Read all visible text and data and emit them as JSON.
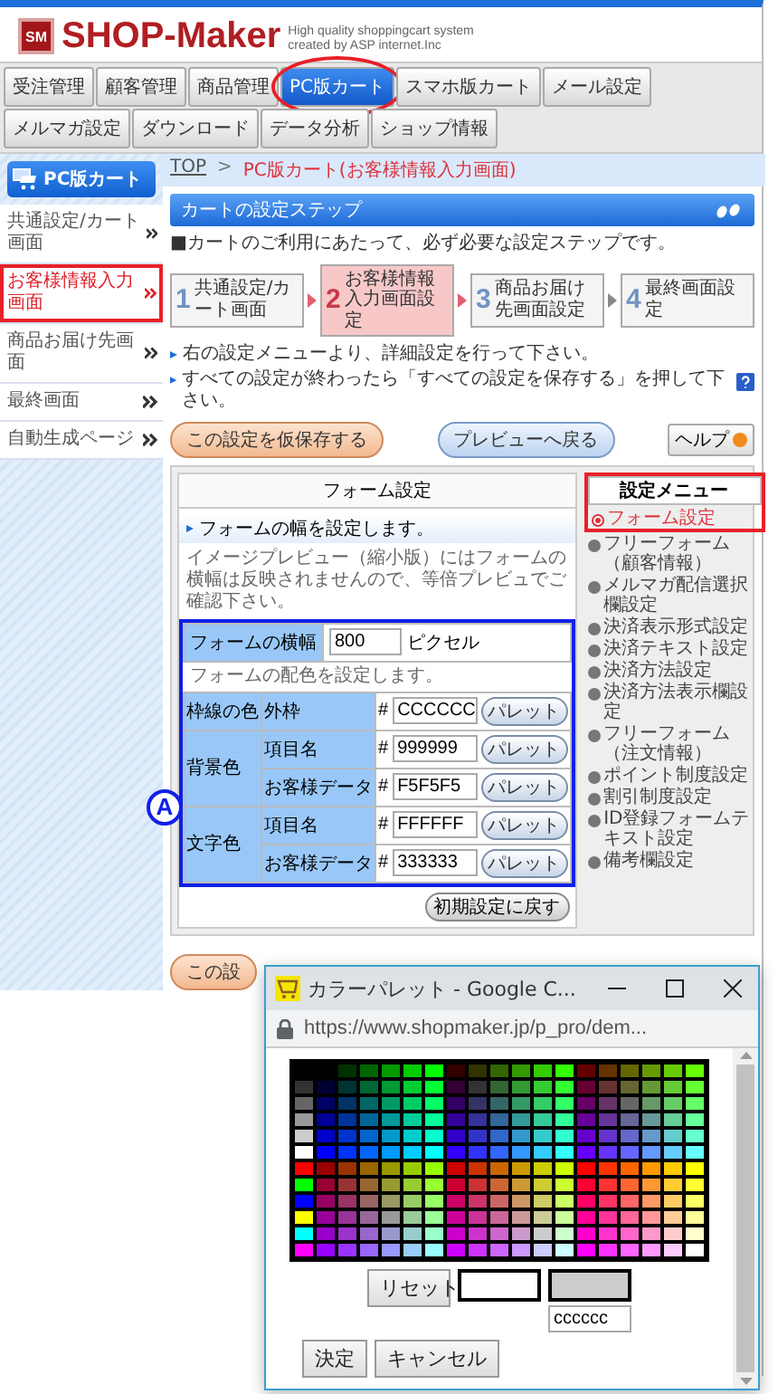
{
  "logo": {
    "mark": "SM",
    "brand": "SHOP-Maker",
    "tagline": [
      "High quality shoppingcart system",
      "created by ASP internet.Inc"
    ]
  },
  "nav": [
    {
      "label": "受注管理",
      "selected": false,
      "highlighted": false
    },
    {
      "label": "顧客管理",
      "selected": false,
      "highlighted": false
    },
    {
      "label": "商品管理",
      "selected": false,
      "highlighted": false
    },
    {
      "label": "PC版カート",
      "selected": true,
      "highlighted": true
    },
    {
      "label": "スマホ版カート",
      "selected": false,
      "highlighted": false
    },
    {
      "label": "メール設定",
      "selected": false,
      "highlighted": false
    },
    {
      "label": "メルマガ設定",
      "selected": false,
      "highlighted": false
    },
    {
      "label": "ダウンロード",
      "selected": false,
      "highlighted": false
    },
    {
      "label": "データ分析",
      "selected": false,
      "highlighted": false
    },
    {
      "label": "ショップ情報",
      "selected": false,
      "highlighted": false
    }
  ],
  "breadcrumb": {
    "home": "TOP",
    "separator": ">",
    "current": "PC版カート(お客様情報入力画面)"
  },
  "sidebar": {
    "title": "PC版カート",
    "items": [
      {
        "label": "共通設定/カート画面",
        "selected": false,
        "highlighted": false
      },
      {
        "label": "お客様情報入力画面",
        "selected": true,
        "highlighted": true
      },
      {
        "label": "商品お届け先画面",
        "selected": false,
        "highlighted": false
      },
      {
        "label": "最終画面",
        "selected": false,
        "highlighted": false
      },
      {
        "label": "自動生成ページ",
        "selected": false,
        "highlighted": false
      }
    ]
  },
  "steps_panel": {
    "title": "カートの設定ステップ",
    "intro": "■カートのご利用にあたって、必ず必要な設定ステップです。",
    "steps": [
      {
        "number": "1",
        "label": "共通設定/カート画面",
        "selected": false
      },
      {
        "number": "2",
        "label": "お客様情報入力画面設定",
        "selected": true
      },
      {
        "number": "3",
        "label": "商品お届け先画面設定",
        "selected": false
      },
      {
        "number": "4",
        "label": "最終画面設定",
        "selected": false
      }
    ]
  },
  "instructions": [
    "右の設定メニューより、詳細設定を行って下さい。",
    "すべての設定が終わったら「すべての設定を保存する」を押して下さい。"
  ],
  "actions": {
    "save": "この設定を仮保存する",
    "preview": "プレビューへ戻る",
    "help": "ヘルプ"
  },
  "form": {
    "title": "フォーム設定",
    "lead": "フォームの幅を設定します。",
    "note": "イメージプレビュー（縮小版）にはフォームの横幅は反映されませんので、等倍プレビュでご確認下さい。",
    "highlighted": true,
    "marker": "A",
    "width_label": "フォームの横幅",
    "width_value": "800",
    "width_unit": "ピクセル",
    "color_lead": "フォームの配色を設定します。",
    "color_groups": [
      {
        "name": "枠線の色",
        "rows": [
          {
            "label": "外枠",
            "prefix": "#",
            "value": "CCCCCC",
            "button": "パレット"
          }
        ]
      },
      {
        "name": "背景色",
        "rows": [
          {
            "label": "項目名",
            "prefix": "#",
            "value": "999999",
            "button": "パレット"
          },
          {
            "label": "お客様データ",
            "prefix": "#",
            "value": "F5F5F5",
            "button": "パレット"
          }
        ]
      },
      {
        "name": "文字色",
        "rows": [
          {
            "label": "項目名",
            "prefix": "#",
            "value": "FFFFFF",
            "button": "パレット"
          },
          {
            "label": "お客様データ",
            "prefix": "#",
            "value": "333333",
            "button": "パレット"
          }
        ]
      }
    ],
    "reset": "初期設定に戻す"
  },
  "settings_menu": {
    "title": "設定メニュー",
    "highlighted": true,
    "items": [
      {
        "label": "フォーム設定",
        "selected": true
      },
      {
        "label": "フリーフォーム（顧客情報）",
        "selected": false
      },
      {
        "label": "メルマガ配信選択欄設定",
        "selected": false
      },
      {
        "label": "決済表示形式設定",
        "selected": false
      },
      {
        "label": "決済テキスト設定",
        "selected": false
      },
      {
        "label": "決済方法設定",
        "selected": false
      },
      {
        "label": "決済方法表示欄設定",
        "selected": false
      },
      {
        "label": "フリーフォーム（注文情報）",
        "selected": false
      },
      {
        "label": "ポイント制度設定",
        "selected": false
      },
      {
        "label": "割引制度設定",
        "selected": false
      },
      {
        "label": "ID登録フォームテキスト設定",
        "selected": false
      },
      {
        "label": "備考欄設定",
        "selected": false
      }
    ]
  },
  "bottom_button": "この設",
  "popup": {
    "title": "カラーパレット - Google C...",
    "url": "https://www.shopmaker.jp/p_pro/dem...",
    "current_value": "cccccc",
    "reset": "リセット",
    "ok": "決定",
    "cancel": "キャンセル"
  }
}
